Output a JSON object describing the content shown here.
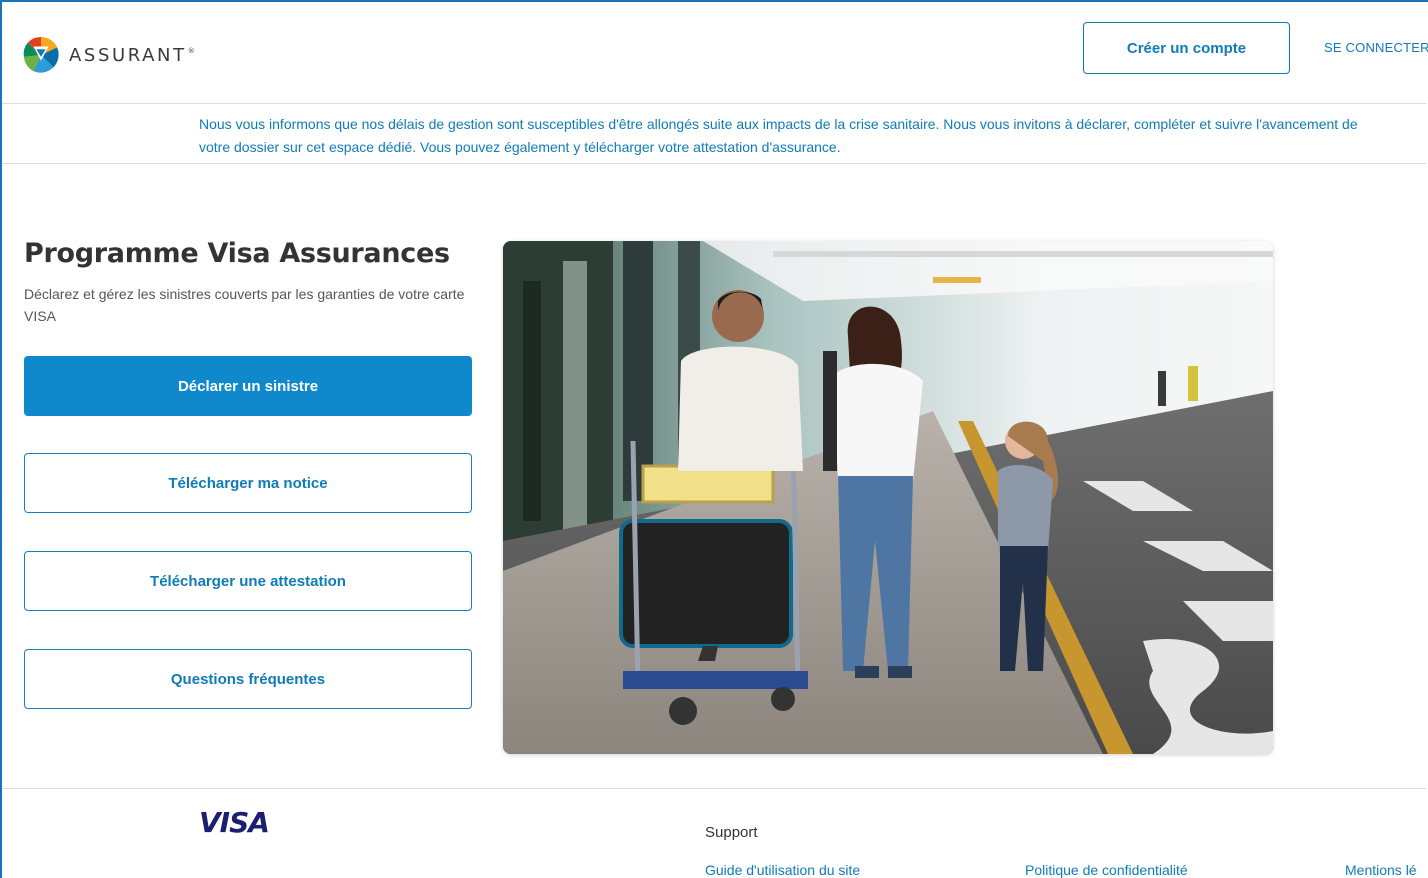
{
  "header": {
    "logo_text": "ASSURANT",
    "logo_mark": "®",
    "create_account": "Créer un compte",
    "login": "SE CONNECTER"
  },
  "notice": {
    "text": "Nous vous informons que nos délais de gestion sont susceptibles d'être allongés suite aux impacts de la crise sanitaire. Nous vous invitons à déclarer, compléter et suivre l'avancement de votre dossier sur cet espace dédié. Vous pouvez également y télécharger votre attestation d'assurance."
  },
  "main": {
    "title": "Programme Visa Assurances",
    "subtitle": "Déclarez et gérez les sinistres couverts par les garanties de votre carte VISA",
    "buttons": [
      {
        "label": "Déclarer un sinistre"
      },
      {
        "label": "Télécharger ma notice"
      },
      {
        "label": "Télécharger une attestation"
      },
      {
        "label": "Questions fréquentes"
      }
    ],
    "hero_icon": "family-airport-photo"
  },
  "footer": {
    "brand": "VISA",
    "support_heading": "Support",
    "links": [
      "Guide d'utilisation du site",
      "Politique de confidentialité",
      "Mentions lé"
    ]
  },
  "colors": {
    "accent": "#0f7cb7",
    "primary_button": "#0f88cc",
    "visa_blue": "#1a1f71"
  }
}
